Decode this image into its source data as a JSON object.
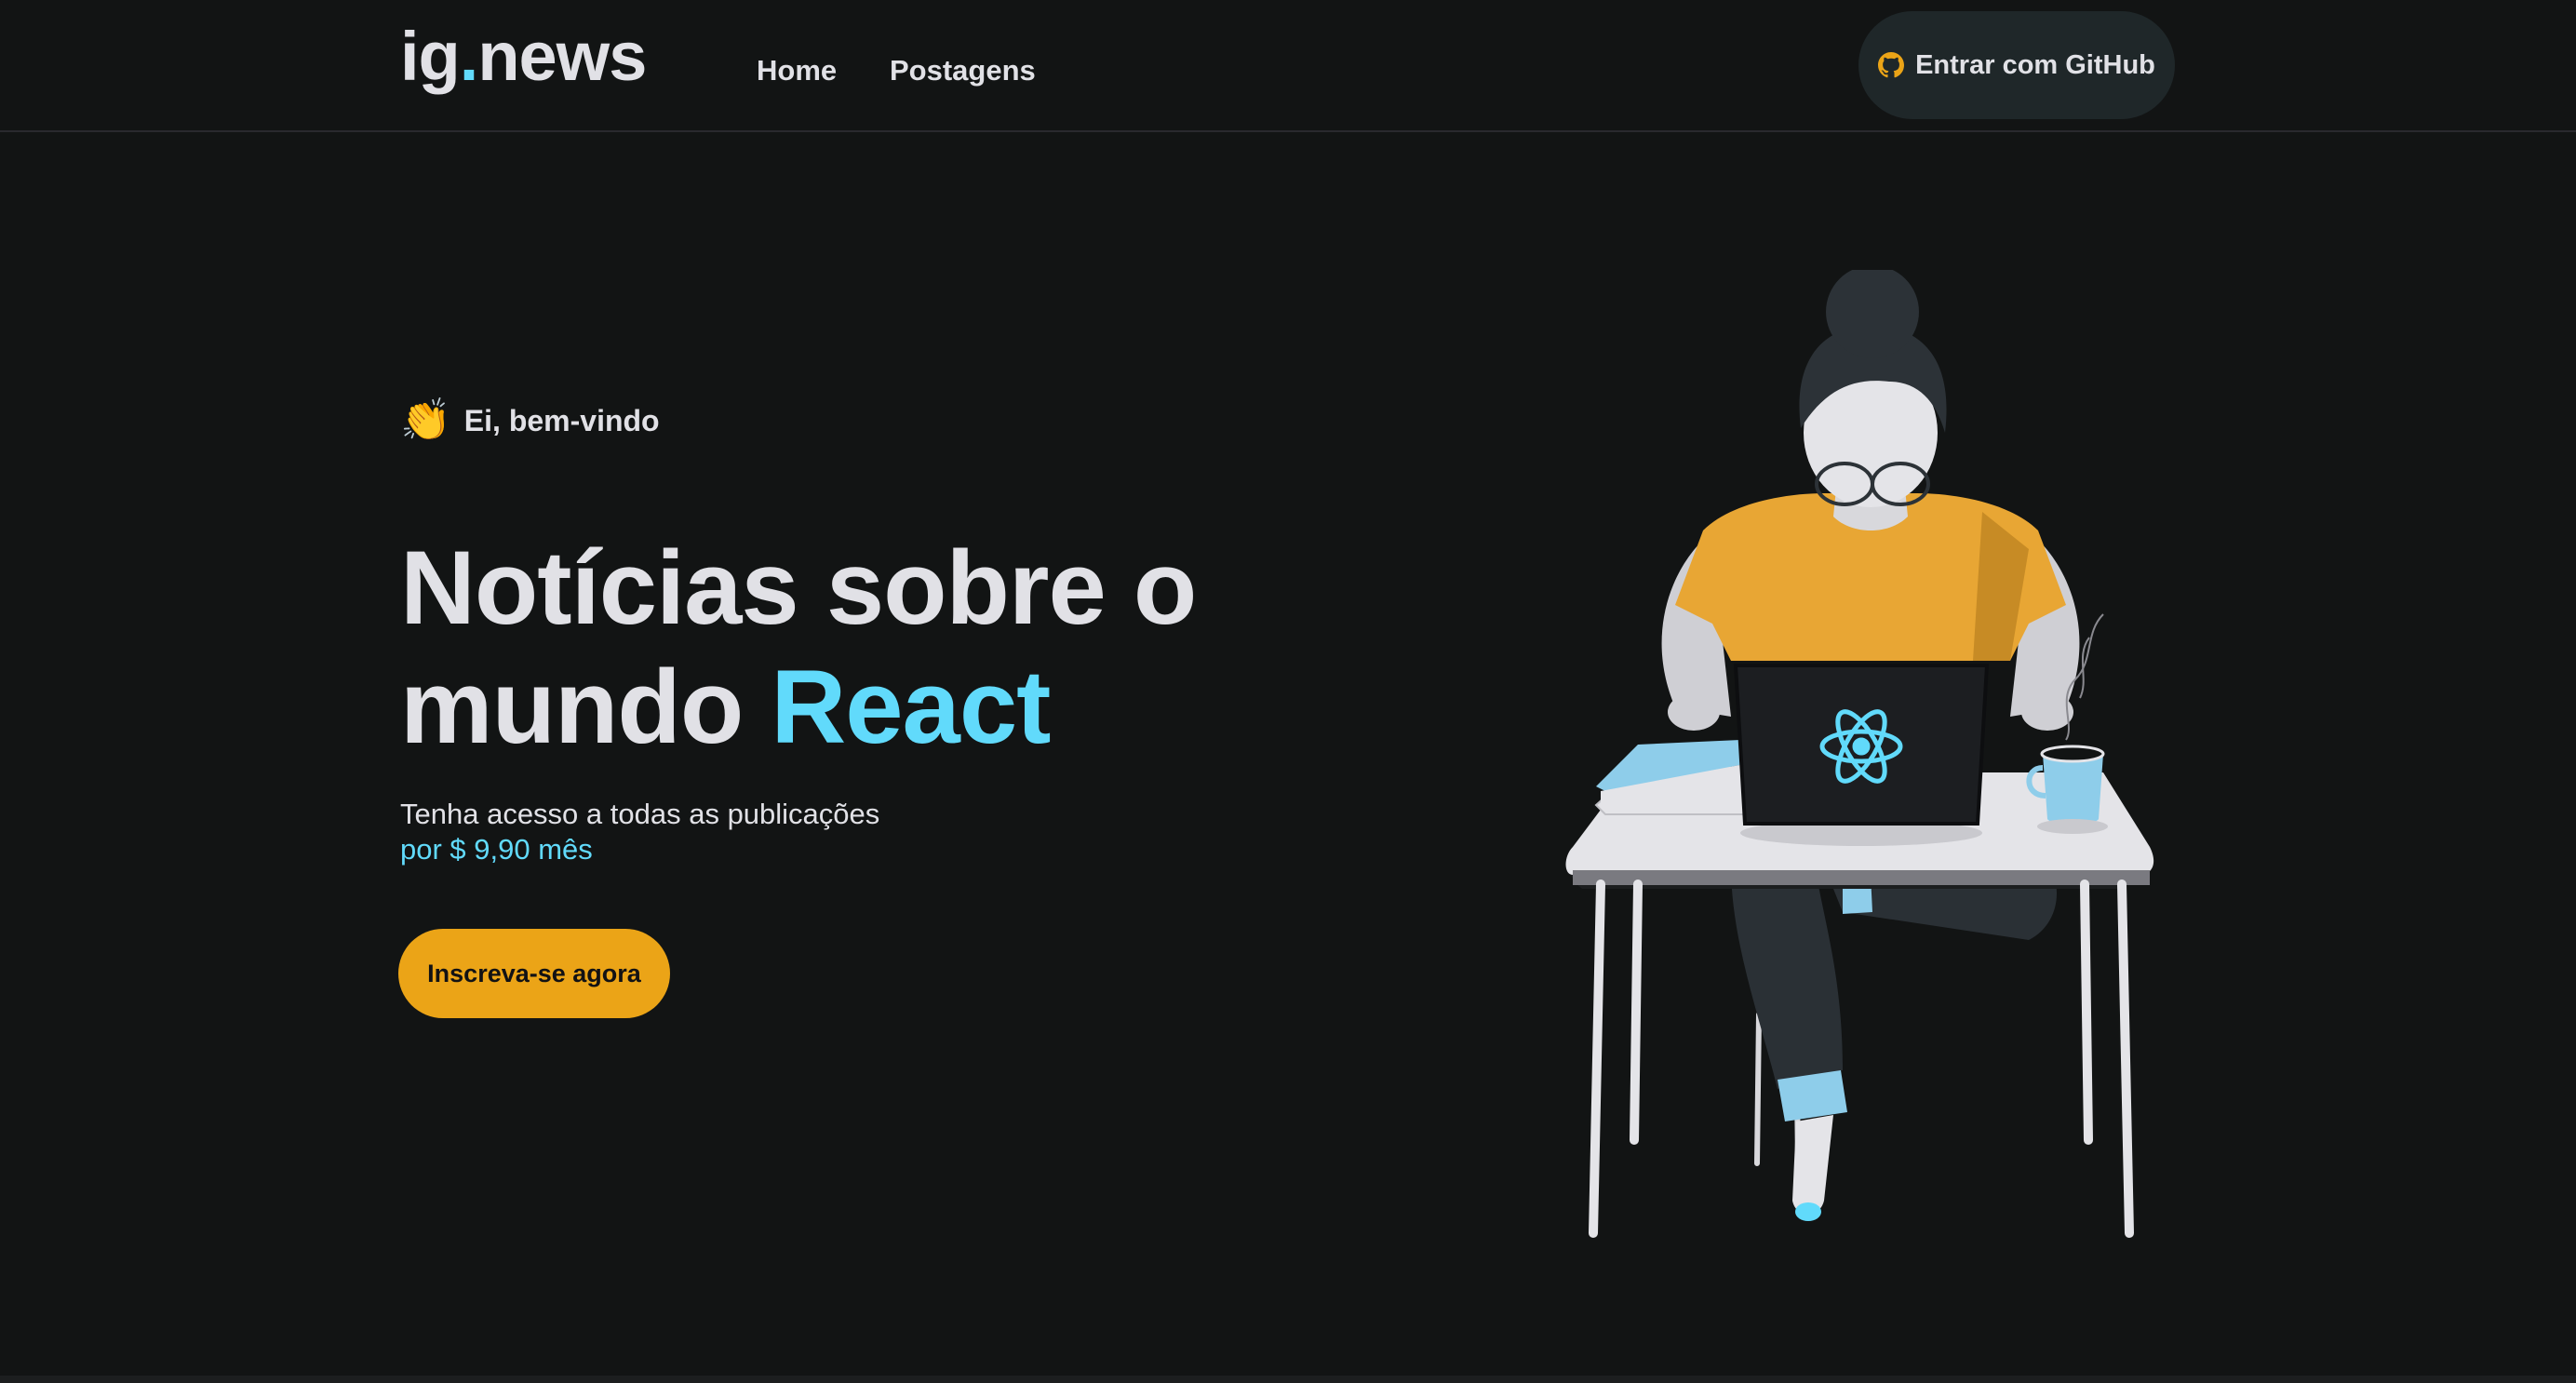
{
  "header": {
    "logo_main": "ig",
    "logo_dot": ".",
    "logo_tail": "news",
    "nav": [
      {
        "label": "Home"
      },
      {
        "label": "Postagens"
      }
    ],
    "signin_label": "Entrar com GitHub",
    "signin_icon": "github-icon"
  },
  "hero": {
    "welcome_emoji": "👏",
    "welcome_text": "Ei, bem-vindo",
    "headline_part1": "Notícias sobre o mundo ",
    "headline_accent": "React",
    "subtitle": "Tenha acesso a todas as publicações",
    "price": "por $ 9,90 mês",
    "cta_label": "Inscreva-se agora"
  },
  "illustration": {
    "name": "girl-coding-illustration",
    "laptop_logo": "react-logo-icon"
  },
  "colors": {
    "background": "#121414",
    "accent_blue": "#61dafb",
    "accent_yellow": "#eba417",
    "text": "#e1e1e6",
    "button_dark": "#1f2729"
  }
}
